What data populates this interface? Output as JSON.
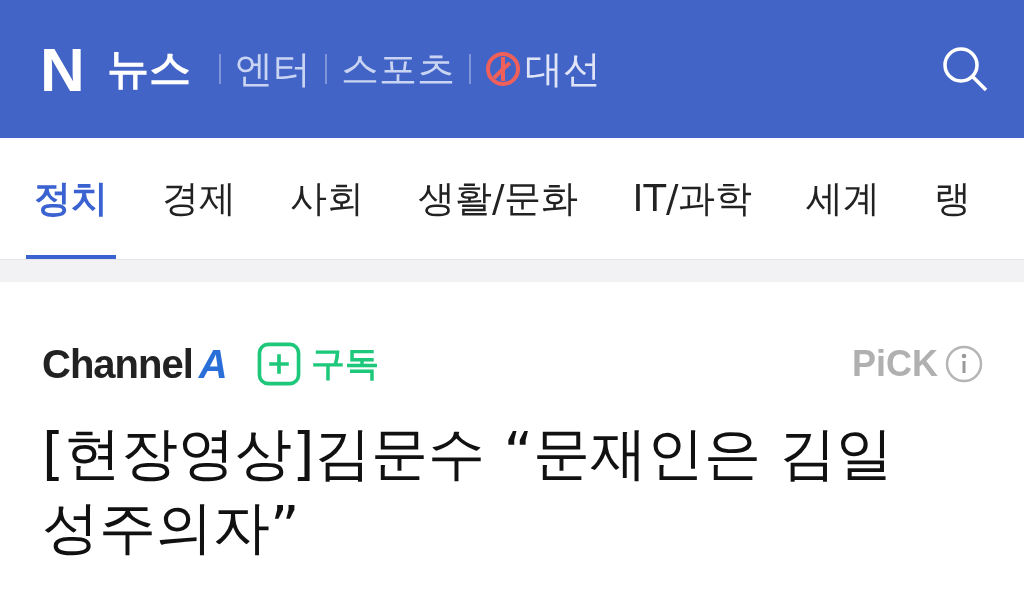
{
  "header": {
    "logo_letter": "N",
    "logo_text": "뉴스",
    "links": [
      {
        "label": "엔터",
        "kind": "plain"
      },
      {
        "label": "스포츠",
        "kind": "plain"
      },
      {
        "label": "대선",
        "kind": "election"
      }
    ]
  },
  "tabs": [
    {
      "label": "정치",
      "selected": true
    },
    {
      "label": "경제",
      "selected": false
    },
    {
      "label": "사회",
      "selected": false
    },
    {
      "label": "생활/문화",
      "selected": false
    },
    {
      "label": "IT/과학",
      "selected": false
    },
    {
      "label": "세계",
      "selected": false
    },
    {
      "label": "랭",
      "selected": false
    }
  ],
  "article": {
    "press": {
      "name": "Channel",
      "mark": "A"
    },
    "subscribe": {
      "label": "구독",
      "subscribed": false
    },
    "pick": "PiCK",
    "headline": "[현장영상]김문수 “문재인은 김일성주의자”"
  }
}
